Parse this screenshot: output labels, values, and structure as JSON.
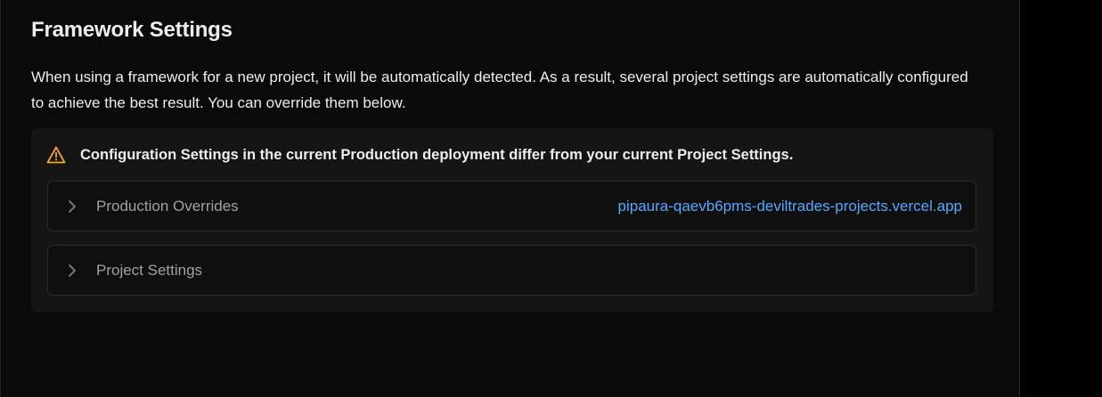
{
  "section": {
    "title": "Framework Settings",
    "description": "When using a framework for a new project, it will be automatically detected. As a result, several project settings are automatically configured to achieve the best result. You can override them below."
  },
  "notice": {
    "icon": "warning-icon",
    "text": "Configuration Settings in the current Production deployment differ from your current Project Settings.",
    "rows": [
      {
        "label": "Production Overrides",
        "link": "pipaura-qaevb6pms-deviltrades-projects.vercel.app"
      },
      {
        "label": "Project Settings"
      }
    ]
  },
  "colors": {
    "background": "#0a0a0a",
    "panel": "#151515",
    "warning": "#f5a623",
    "link": "#52a8ff"
  }
}
